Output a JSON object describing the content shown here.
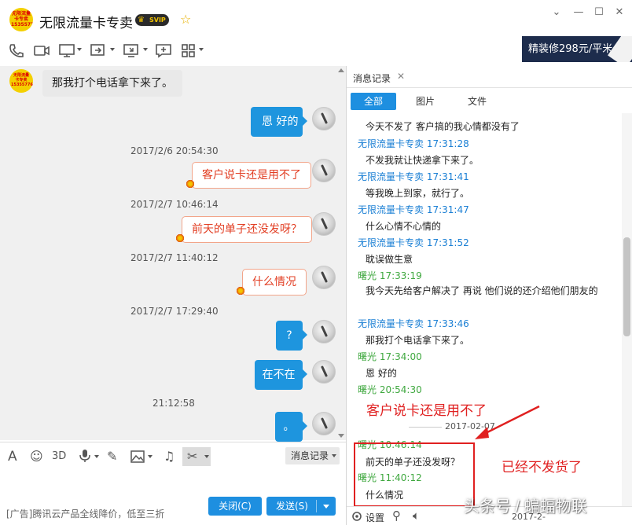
{
  "window": {
    "title": "无限流量卡专卖",
    "badge": "SVIP",
    "logo_text": "无限流量 卡专卖 15355776"
  },
  "ad_banner": "精装修298元/平米",
  "chat": {
    "messages": [
      {
        "side": "left",
        "text": "那我打个电话拿下来了。"
      },
      {
        "side": "right",
        "style": "blue",
        "text": "恩 好的"
      },
      {
        "timestamp": "2017/2/6 20:54:30"
      },
      {
        "side": "right",
        "style": "paper",
        "text": "客户说卡还是用不了"
      },
      {
        "timestamp": "2017/2/7 10:46:14"
      },
      {
        "side": "right",
        "style": "paper",
        "text": "前天的单子还没发呀？"
      },
      {
        "timestamp": "2017/2/7 11:40:12"
      },
      {
        "side": "right",
        "style": "paper",
        "text": "什么情况"
      },
      {
        "timestamp": "2017/2/7 17:29:40"
      },
      {
        "side": "right",
        "style": "blue",
        "text": "?"
      },
      {
        "side": "right",
        "style": "blue",
        "text": "在不在"
      },
      {
        "timestamp": "21:12:58"
      },
      {
        "side": "right",
        "style": "blue",
        "text": "。"
      }
    ]
  },
  "input_toolbar": {
    "history_label": "消息记录"
  },
  "footer": {
    "ad_text": "[广告]腾讯云产品全线降价，低至三折",
    "close_label": "关闭(C)",
    "send_label": "发送(S)"
  },
  "history_panel": {
    "tab_title": "消息记录",
    "filters": [
      "全部",
      "图片",
      "文件"
    ],
    "entries": [
      {
        "type": "msg",
        "text": "今天不发了 客户搞的我心情都没有了"
      },
      {
        "type": "sender",
        "name": "无限流量卡专卖 17:31:28",
        "color": "blue"
      },
      {
        "type": "msg",
        "text": "不发我就让快递拿下来了。"
      },
      {
        "type": "sender",
        "name": "无限流量卡专卖 17:31:41",
        "color": "blue"
      },
      {
        "type": "msg",
        "text": "等我晚上到家，就行了。"
      },
      {
        "type": "sender",
        "name": "无限流量卡专卖 17:31:47",
        "color": "blue"
      },
      {
        "type": "msg",
        "text": "什么心情不心情的"
      },
      {
        "type": "sender",
        "name": "无限流量卡专卖 17:31:52",
        "color": "blue"
      },
      {
        "type": "msg",
        "text": "耽误做生意"
      },
      {
        "type": "sender",
        "name": "曙光 17:33:19",
        "color": "green"
      },
      {
        "type": "msg",
        "text": "我今天先给客户解决了 再说 他们说的还介绍他们朋友的"
      },
      {
        "type": "sender",
        "name": "无限流量卡专卖 17:33:46",
        "color": "blue"
      },
      {
        "type": "msg",
        "text": "那我打个电话拿下来了。"
      },
      {
        "type": "sender",
        "name": "曙光 17:34:00",
        "color": "green"
      },
      {
        "type": "msg",
        "text": "恩 好的"
      },
      {
        "type": "sender",
        "name": "曙光 20:54:30",
        "color": "green"
      },
      {
        "type": "sender",
        "name": "曙光 10:46:14",
        "color": "green"
      },
      {
        "type": "msg",
        "text": "前天的单子还没发呀？"
      },
      {
        "type": "sender",
        "name": "曙光 11:40:12",
        "color": "green"
      },
      {
        "type": "msg",
        "text": "什么情况"
      }
    ],
    "date_separator": "2017-02-07",
    "settings_label": "设置",
    "bottom_date": "2017-2-"
  },
  "annotations": {
    "upper": "客户说卡还是用不了",
    "lower": "已经不发货了"
  },
  "watermark": "头条号 / 蝙蝠物联",
  "colors": {
    "accent_blue": "#1e8fe0",
    "bubble_blue": "#1e95de",
    "sender_blue": "#1a7fd4",
    "sender_green": "#3fa83f",
    "annotation_red": "#e02020"
  }
}
